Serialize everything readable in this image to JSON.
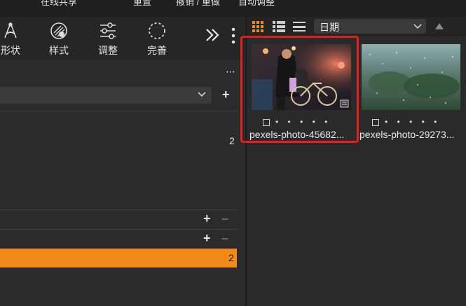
{
  "topbar": {
    "items": [
      "在线共享",
      "重置",
      "撤销 / 重做",
      "自动调整"
    ]
  },
  "toolbar": {
    "tools": [
      {
        "label": "形状",
        "icon": "shape-icon"
      },
      {
        "label": "样式",
        "icon": "style-icon"
      },
      {
        "label": "调整",
        "icon": "adjust-sliders-icon"
      },
      {
        "label": "完善",
        "icon": "refine-circle-icon"
      }
    ],
    "more_icon": "double-chevron-right-icon",
    "menu_icon": "vertical-dots-icon"
  },
  "left_panel": {
    "row1_count": "2",
    "orange_row_count": "2",
    "accent_color": "#f28a1a"
  },
  "right_panel": {
    "sort_select": "日期",
    "thumbnails": [
      {
        "caption": "pexels-photo-45682...",
        "selected": true
      },
      {
        "caption": "pexels-photo-29273...",
        "selected": false
      }
    ],
    "selection_color": "#e0201c"
  }
}
